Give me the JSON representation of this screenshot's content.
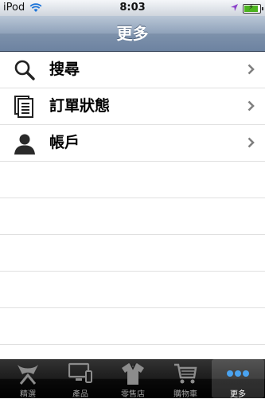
{
  "status_bar": {
    "carrier": "iPod",
    "time": "8:03",
    "battery_level": 0.9,
    "battery_color": "#4cb320"
  },
  "nav": {
    "title": "更多"
  },
  "menu": {
    "items": [
      {
        "label": "搜尋",
        "icon": "search-icon"
      },
      {
        "label": "訂單狀態",
        "icon": "documents-icon"
      },
      {
        "label": "帳戶",
        "icon": "person-icon"
      }
    ]
  },
  "tabbar": {
    "tabs": [
      {
        "label": "精選",
        "icon": "featured-icon"
      },
      {
        "label": "產品",
        "icon": "devices-icon"
      },
      {
        "label": "零售店",
        "icon": "shirt-icon"
      },
      {
        "label": "購物車",
        "icon": "cart-icon"
      },
      {
        "label": "更多",
        "icon": "more-icon",
        "active": true
      }
    ]
  },
  "colors": {
    "nav_bar": "#7d91ab",
    "tab_bar": "#000000",
    "separator": "#e0e0e0",
    "active_tab": "#ffffff"
  }
}
